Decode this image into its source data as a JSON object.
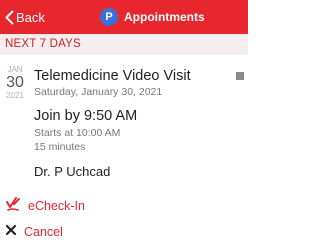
{
  "navbar": {
    "back_label": "Back",
    "app_icon_letter": "P",
    "title": "Appointments"
  },
  "section": {
    "header": "NEXT 7 DAYS"
  },
  "appointment": {
    "month": "JAN",
    "day": "30",
    "year": "2021",
    "title": "Telemedicine Video Visit",
    "date_text": "Saturday, January 30, 2021",
    "join_by": "Join by 9:50 AM",
    "starts_at": "Starts at 10:00 AM",
    "duration": "15 minutes",
    "provider": "Dr. P Uchcad"
  },
  "actions": {
    "echeck_label": "eCheck-In",
    "cancel_label": "Cancel"
  },
  "colors": {
    "accent": "#e8262e",
    "section_bg": "#f4eeee",
    "app_icon": "#3b6fd8"
  }
}
